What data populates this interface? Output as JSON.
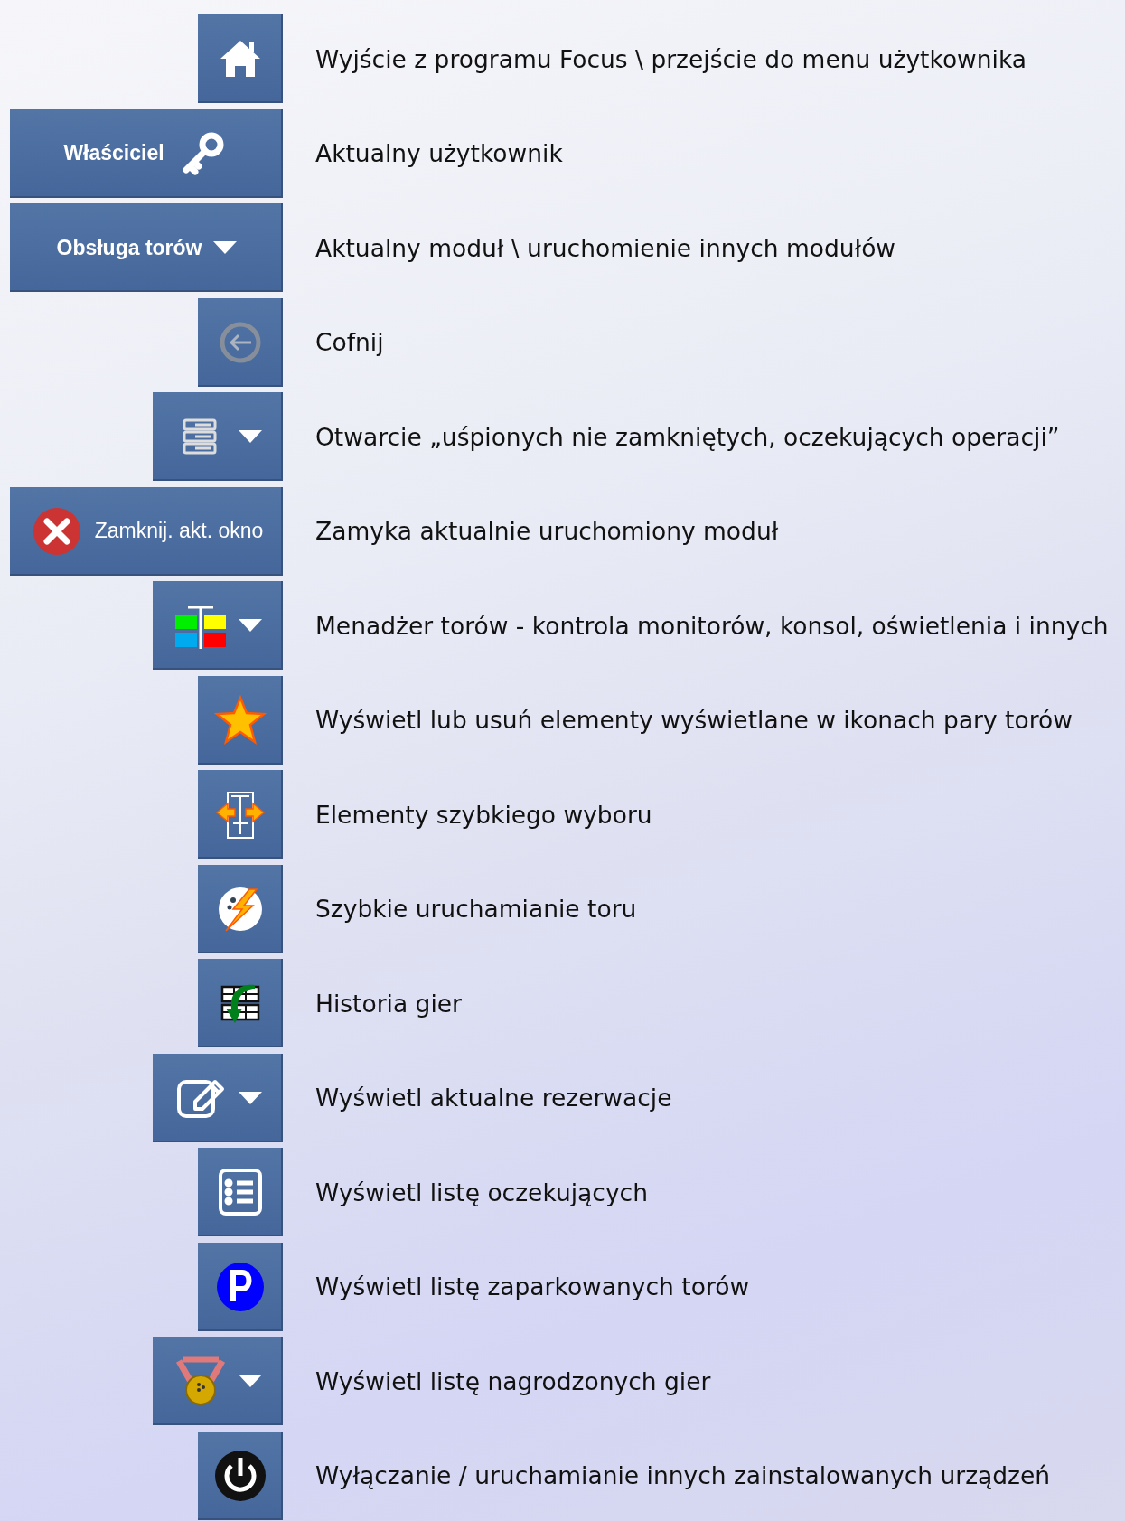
{
  "items": [
    {
      "kind": "icon",
      "disabled": false,
      "description": "Wyjście z programu Focus \\ przejście do menu  użytkownika"
    },
    {
      "kind": "label-icon",
      "disabled": false,
      "label": "Właściciel",
      "description": "Aktualny użytkownik"
    },
    {
      "kind": "label-menu",
      "disabled": false,
      "label": "Obsługa torów",
      "description": "Aktualny moduł \\ uruchomienie innych modułów"
    },
    {
      "kind": "icon",
      "disabled": true,
      "description": "Cofnij"
    },
    {
      "kind": "icon-menu",
      "disabled": false,
      "description": "Otwarcie „uśpionych nie zamkniętych, oczekujących operacji”"
    },
    {
      "kind": "icon-label",
      "disabled": false,
      "label": "Zamknij. akt. okno",
      "description": "Zamyka aktualnie uruchomiony moduł"
    },
    {
      "kind": "icon-menu",
      "disabled": false,
      "description": "Menadżer torów - kontrola monitorów, konsol, oświetlenia i innych"
    },
    {
      "kind": "icon",
      "disabled": false,
      "description": "Wyświetl lub usuń elementy wyświetlane w ikonach pary torów"
    },
    {
      "kind": "icon",
      "disabled": false,
      "description": "Elementy szybkiego wyboru"
    },
    {
      "kind": "icon",
      "disabled": false,
      "description": "Szybkie uruchamianie toru"
    },
    {
      "kind": "icon",
      "disabled": false,
      "description": "Historia gier"
    },
    {
      "kind": "icon-menu",
      "disabled": false,
      "description": "Wyświetl aktualne rezerwacje"
    },
    {
      "kind": "icon",
      "disabled": false,
      "description": "Wyświetl listę oczekujących"
    },
    {
      "kind": "icon",
      "disabled": false,
      "description": "Wyświetl listę zaparkowanych torów"
    },
    {
      "kind": "icon-menu",
      "disabled": false,
      "description": "Wyświetl listę nagrodzonych gier"
    },
    {
      "kind": "icon",
      "disabled": false,
      "description": "Wyłączanie / uruchamianie innych zainstalowanych urządzeń"
    }
  ]
}
